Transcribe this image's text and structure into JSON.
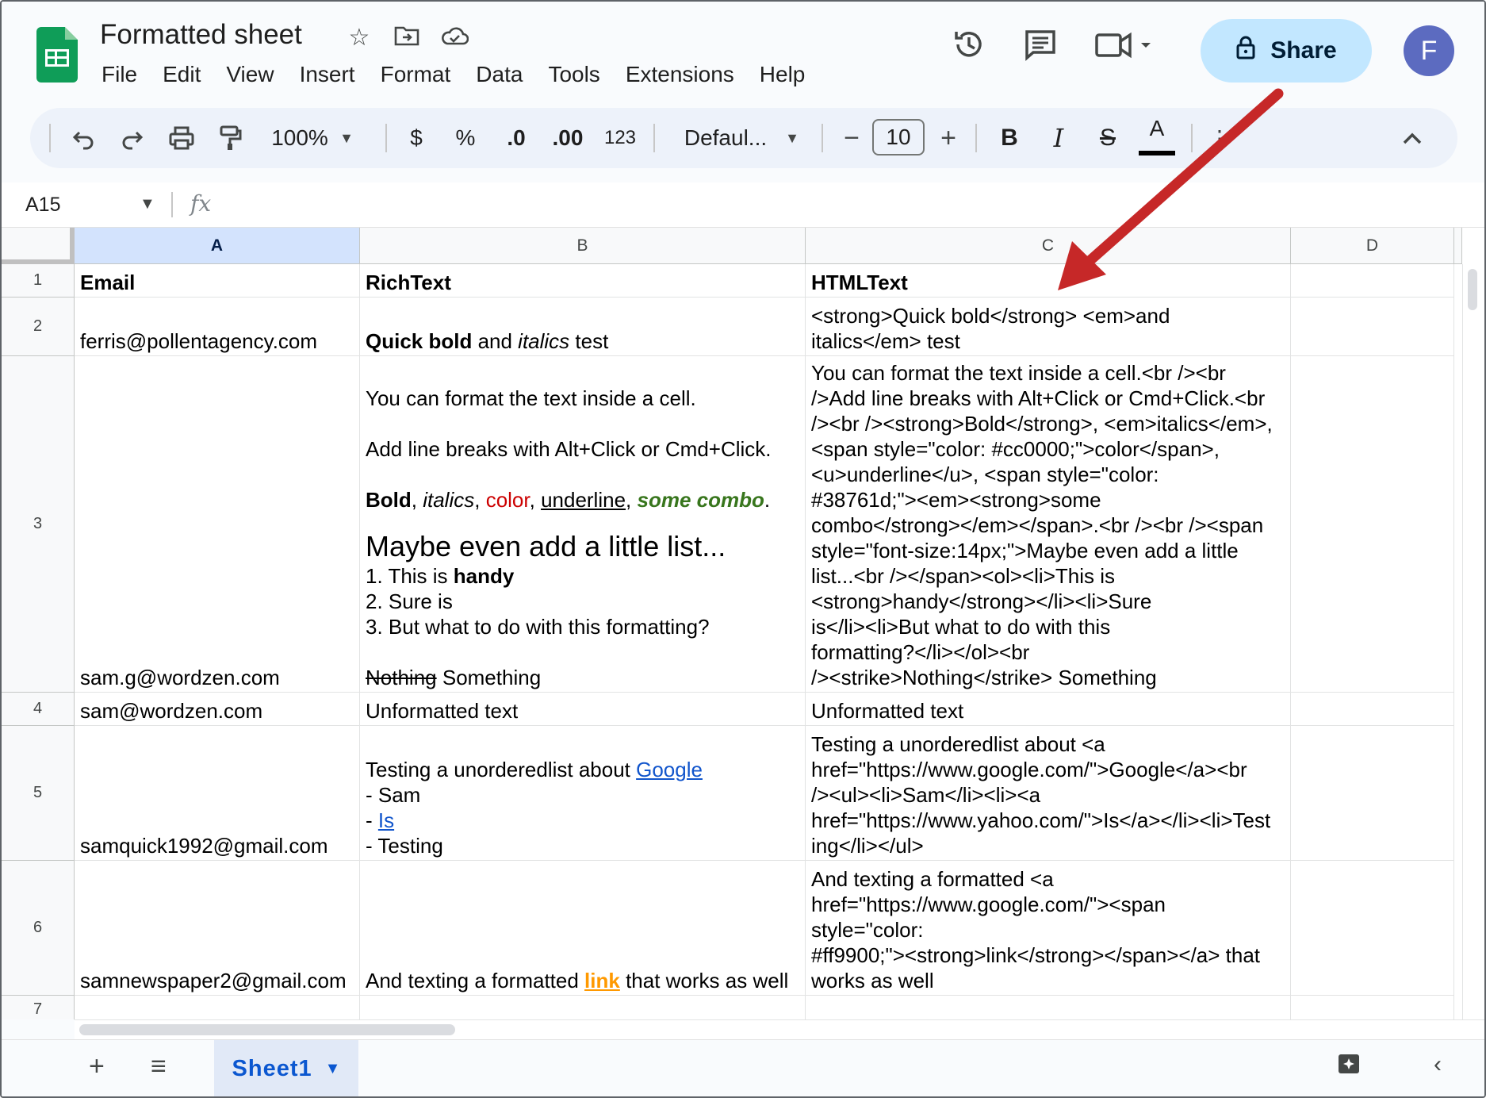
{
  "app": {
    "doc_title": "Formatted sheet",
    "menus": [
      "File",
      "Edit",
      "View",
      "Insert",
      "Format",
      "Data",
      "Tools",
      "Extensions",
      "Help"
    ],
    "share_label": "Share",
    "avatar_initial": "F"
  },
  "toolbar": {
    "zoom": "100%",
    "currency": "$",
    "percent": "%",
    "dec_decrease": ".0",
    "dec_increase": ".00",
    "number_format": "123",
    "font": "Defaul...",
    "font_size": "10",
    "bold": "B",
    "italic": "I",
    "strike": "S",
    "text_color": "A",
    "text_color_value": "#000000"
  },
  "formula_bar": {
    "cell_ref": "A15",
    "fx": "fx"
  },
  "columns": [
    "A",
    "B",
    "C",
    "D"
  ],
  "rows": [
    {
      "num": "1",
      "email": "Email",
      "rich": [
        "RichText"
      ],
      "html": [
        "HTMLText"
      ]
    },
    {
      "num": "2",
      "email": "ferris@pollentagency.com",
      "rich_parts": {
        "bold": "Quick bold",
        "mid": " and ",
        "ital": "italics",
        "end": " test"
      },
      "html": [
        "<strong>Quick bold</strong> <em>and",
        "italics</em> test"
      ]
    },
    {
      "num": "3",
      "email": "sam.g@wordzen.com",
      "rich_parts": {
        "l1": "You can format the text inside a cell.",
        "l2": "Add line breaks with Alt+Click or Cmd+Click.",
        "bold": "Bold",
        "sep1": ", ",
        "ital": "italics",
        "sep2": ", ",
        "color": "color",
        "sep3": ", ",
        "under": "underline",
        "sep4": ", ",
        "combo": "some combo",
        "dot": ".",
        "big": "Maybe even add a little list...",
        "li1a": "1. This is ",
        "li1b": "handy",
        "li2": "2. Sure is",
        "li3": "3. But what to do with this formatting?",
        "strike": "Nothing",
        "after": " Something"
      },
      "html": [
        "You can format the text inside a cell.<br /><br",
        "/>Add line breaks with Alt+Click or Cmd+Click.<br",
        "/><br /><strong>Bold</strong>, <em>italics</em>,",
        "<span style=\"color: #cc0000;\">color</span>,",
        "<u>underline</u>, <span style=\"color:",
        "#38761d;\"><em><strong>some",
        "combo</strong></em></span>.<br /><br /><span",
        "style=\"font-size:14px;\">Maybe even add a little",
        "list...<br /></span><ol><li>This is",
        "<strong>handy</strong></li><li>Sure",
        "is</li><li>But what to do with this",
        "formatting?</li></ol><br",
        "/><strike>Nothing</strike> Something"
      ]
    },
    {
      "num": "4",
      "email": "sam@wordzen.com",
      "rich": [
        "Unformatted text"
      ],
      "html": [
        "Unformatted text"
      ]
    },
    {
      "num": "5",
      "email": "samquick1992@gmail.com",
      "rich_parts": {
        "l1a": "Testing a unorderedlist about ",
        "l1link": "Google",
        "l2": "- Sam",
        "l3a": "- ",
        "l3link": "Is",
        "l4": "- Testing"
      },
      "html": [
        "Testing a unorderedlist about <a",
        "href=\"https://www.google.com/\">Google</a><br",
        "/><ul><li>Sam</li><li><a",
        "href=\"https://www.yahoo.com/\">Is</a></li><li>Test",
        "ing</li></ul>"
      ]
    },
    {
      "num": "6",
      "email": "samnewspaper2@gmail.com",
      "rich_parts": {
        "a": "And texting a formatted ",
        "link": "link",
        "b": " that works as well"
      },
      "html": [
        "And texting a formatted <a",
        "href=\"https://www.google.com/\"><span",
        "style=\"color:",
        "#ff9900;\"><strong>link</strong></span></a> that",
        "works as well"
      ]
    },
    {
      "num": "7"
    }
  ],
  "sheet_tab": "Sheet1",
  "colors": {
    "accent": "#0b57d0",
    "share_bg": "#c2e7ff",
    "red": "#cc0000",
    "green": "#38761d",
    "orange": "#ff9900",
    "link_blue": "#1155cc",
    "annotation_arrow": "#c62828"
  }
}
